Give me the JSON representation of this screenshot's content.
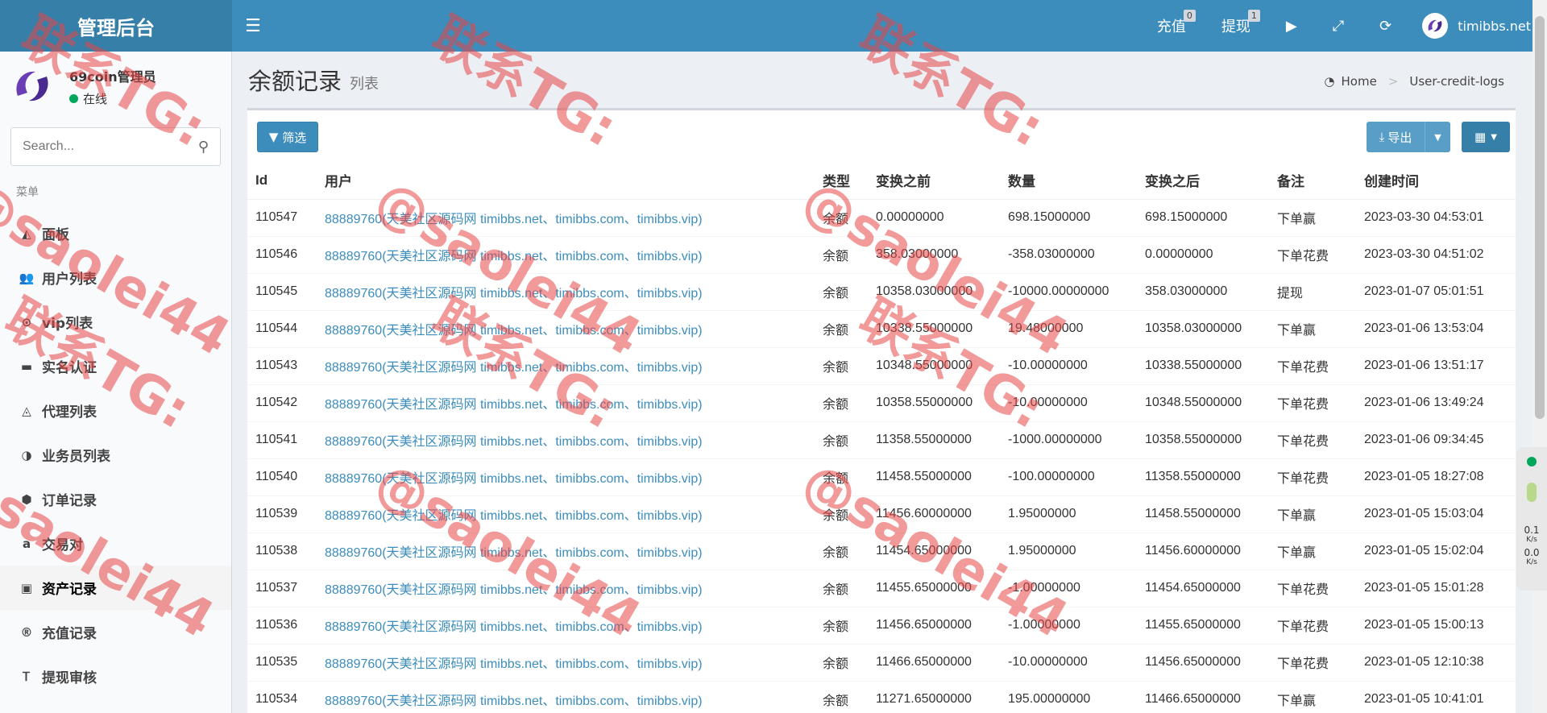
{
  "header": {
    "app_title": "管理后台",
    "recharge_label": "充值",
    "recharge_badge": "0",
    "withdraw_label": "提现",
    "withdraw_badge": "1",
    "site_name": "timibbs.net"
  },
  "sidebar": {
    "user_name": "69coin管理员",
    "user_status": "在线",
    "search_placeholder": "Search...",
    "menu_header": "菜单",
    "items": [
      {
        "label": "面板",
        "icon": "area-chart-icon"
      },
      {
        "label": "用户列表",
        "icon": "users-icon"
      },
      {
        "label": "vip列表",
        "icon": "chevron-circle-icon"
      },
      {
        "label": "实名认证",
        "icon": "credit-card-icon"
      },
      {
        "label": "代理列表",
        "icon": "caret-circle-icon"
      },
      {
        "label": "业务员列表",
        "icon": "adjust-icon"
      },
      {
        "label": "订单记录",
        "icon": "cube-icon"
      },
      {
        "label": "交易对",
        "icon": "amazon-icon"
      },
      {
        "label": "资产记录",
        "icon": "money-icon"
      },
      {
        "label": "充值记录",
        "icon": "registered-icon"
      },
      {
        "label": "提现审核",
        "icon": "text-height-icon"
      }
    ],
    "active_index": 8
  },
  "page": {
    "title": "余额记录",
    "subtitle": "列表",
    "breadcrumb_home": "Home",
    "breadcrumb_current": "User-credit-logs"
  },
  "toolbar": {
    "filter_label": "筛选",
    "export_label": "导出"
  },
  "table": {
    "columns": [
      "Id",
      "用户",
      "类型",
      "变换之前",
      "数量",
      "变换之后",
      "备注",
      "创建时间"
    ],
    "rows": [
      [
        "110547",
        "88889760(天美社区源码网 timibbs.net、timibbs.com、timibbs.vip)",
        "余额",
        "0.00000000",
        "698.15000000",
        "698.15000000",
        "下单赢",
        "2023-03-30 04:53:01"
      ],
      [
        "110546",
        "88889760(天美社区源码网 timibbs.net、timibbs.com、timibbs.vip)",
        "余额",
        "358.03000000",
        "-358.03000000",
        "0.00000000",
        "下单花费",
        "2023-03-30 04:51:02"
      ],
      [
        "110545",
        "88889760(天美社区源码网 timibbs.net、timibbs.com、timibbs.vip)",
        "余额",
        "10358.03000000",
        "-10000.00000000",
        "358.03000000",
        "提现",
        "2023-01-07 05:01:51"
      ],
      [
        "110544",
        "88889760(天美社区源码网 timibbs.net、timibbs.com、timibbs.vip)",
        "余额",
        "10338.55000000",
        "19.48000000",
        "10358.03000000",
        "下单赢",
        "2023-01-06 13:53:04"
      ],
      [
        "110543",
        "88889760(天美社区源码网 timibbs.net、timibbs.com、timibbs.vip)",
        "余额",
        "10348.55000000",
        "-10.00000000",
        "10338.55000000",
        "下单花费",
        "2023-01-06 13:51:17"
      ],
      [
        "110542",
        "88889760(天美社区源码网 timibbs.net、timibbs.com、timibbs.vip)",
        "余额",
        "10358.55000000",
        "-10.00000000",
        "10348.55000000",
        "下单花费",
        "2023-01-06 13:49:24"
      ],
      [
        "110541",
        "88889760(天美社区源码网 timibbs.net、timibbs.com、timibbs.vip)",
        "余额",
        "11358.55000000",
        "-1000.00000000",
        "10358.55000000",
        "下单花费",
        "2023-01-06 09:34:45"
      ],
      [
        "110540",
        "88889760(天美社区源码网 timibbs.net、timibbs.com、timibbs.vip)",
        "余额",
        "11458.55000000",
        "-100.00000000",
        "11358.55000000",
        "下单花费",
        "2023-01-05 18:27:08"
      ],
      [
        "110539",
        "88889760(天美社区源码网 timibbs.net、timibbs.com、timibbs.vip)",
        "余额",
        "11456.60000000",
        "1.95000000",
        "11458.55000000",
        "下单赢",
        "2023-01-05 15:03:04"
      ],
      [
        "110538",
        "88889760(天美社区源码网 timibbs.net、timibbs.com、timibbs.vip)",
        "余额",
        "11454.65000000",
        "1.95000000",
        "11456.60000000",
        "下单赢",
        "2023-01-05 15:02:04"
      ],
      [
        "110537",
        "88889760(天美社区源码网 timibbs.net、timibbs.com、timibbs.vip)",
        "余额",
        "11455.65000000",
        "-1.00000000",
        "11454.65000000",
        "下单花费",
        "2023-01-05 15:01:28"
      ],
      [
        "110536",
        "88889760(天美社区源码网 timibbs.net、timibbs.com、timibbs.vip)",
        "余额",
        "11456.65000000",
        "-1.00000000",
        "11455.65000000",
        "下单花费",
        "2023-01-05 15:00:13"
      ],
      [
        "110535",
        "88889760(天美社区源码网 timibbs.net、timibbs.com、timibbs.vip)",
        "余额",
        "11466.65000000",
        "-10.00000000",
        "11456.65000000",
        "下单花费",
        "2023-01-05 12:10:38"
      ],
      [
        "110534",
        "88889760(天美社区源码网 timibbs.net、timibbs.com、timibbs.vip)",
        "余额",
        "11271.65000000",
        "195.00000000",
        "11466.65000000",
        "下单赢",
        "2023-01-05 10:41:01"
      ]
    ]
  },
  "watermark": {
    "line1": "联系TG:",
    "line2": "@saolei44"
  },
  "net_widget": {
    "up": "0.1",
    "down": "0.0",
    "unit": "K/s"
  },
  "colors": {
    "header_bg": "#3c8dbc",
    "logo_bg": "#367fa9",
    "link": "#3c8dbc",
    "watermark": "#e84646"
  }
}
